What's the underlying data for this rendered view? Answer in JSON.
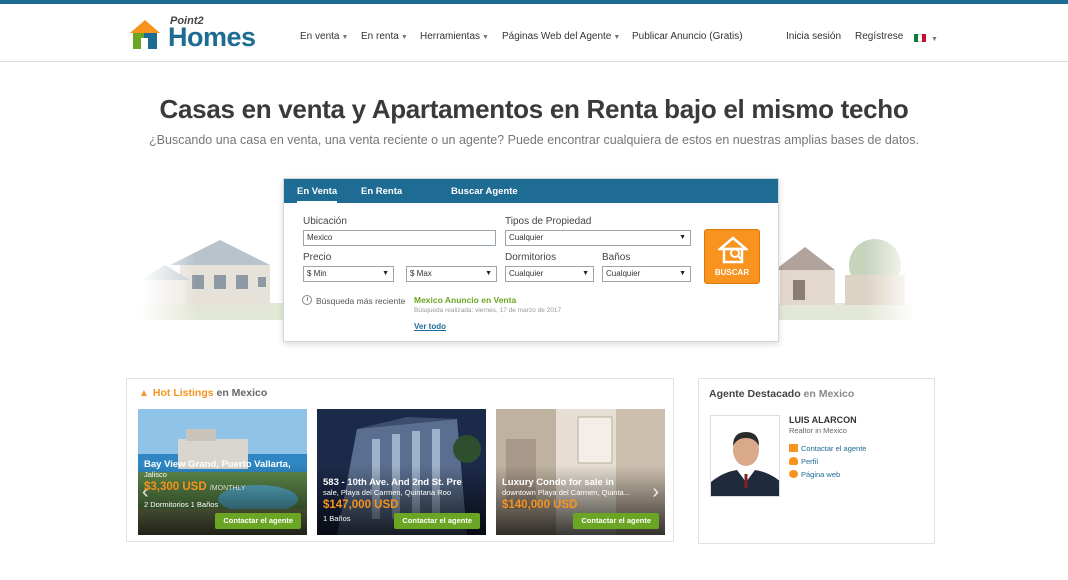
{
  "header": {
    "logo_top": "Point2",
    "logo_main": "Homes",
    "nav": [
      "En venta",
      "En renta",
      "Herramientas",
      "Páginas Web del Agente"
    ],
    "publish": "Publicar Anuncio (Gratis)",
    "login": "Inicia sesión",
    "register": "Regístrese"
  },
  "hero": {
    "title": "Casas en venta y Apartamentos en Renta bajo el mismo techo",
    "subtitle": "¿Buscando una casa en venta, una venta reciente o un agente? Puede encontrar cualquiera de estos en nuestras amplias bases de datos."
  },
  "search": {
    "tabs": [
      "En Venta",
      "En Renta",
      "Buscar Agente"
    ],
    "location_label": "Ubicación",
    "location_value": "Mexico",
    "property_type_label": "Tipos de Propiedad",
    "property_type_value": "Cualquier",
    "price_label": "Precio",
    "price_min": "$ Min",
    "price_max": "$ Max",
    "bedrooms_label": "Dormitorios",
    "bedrooms_value": "Cualquier",
    "baths_label": "Baños",
    "baths_value": "Cualquier",
    "button": "BUSCAR",
    "recent_label": "Búsqueda más reciente",
    "recent_link": "Mexico Anuncio en Venta",
    "recent_date": "Búsqueda realizada: viernes, 17 de marzo de 2017",
    "see_all": "Ver todo"
  },
  "listings": {
    "heading_hl": "Hot Listings",
    "heading_rest": "en Mexico",
    "cards": [
      {
        "title": "Bay View Grand, Puerto Vallarta,",
        "location": "Jalisco",
        "price": "$3,300 USD",
        "period": "/MONTHLY",
        "meta": "2 Dormitorios    1 Baños",
        "button": "Contactar el agente"
      },
      {
        "title": "583 - 10th Ave. And 2nd St. Pre",
        "location": "sale, Playa del Carmen, Quintana Roo",
        "price": "$147,000 USD",
        "period": "",
        "meta": "1 Baños",
        "button": "Contactar el agente"
      },
      {
        "title": "Luxury Condo for sale in",
        "location": "downtown Playa del Carmen, Quinta...",
        "price": "$140,000 USD",
        "period": "",
        "meta": "",
        "button": "Contactar el agente"
      }
    ]
  },
  "agent": {
    "heading": "Agente Destacado",
    "heading_rest": "en Mexico",
    "name": "LUIS ALARCON",
    "role": "Realtor in Mexico",
    "links": [
      "Contactar el agente",
      "Perfil",
      "Página web"
    ]
  },
  "colors": {
    "brand_blue": "#1e6b93",
    "accent_orange": "#f7931e",
    "action_green": "#6aa623"
  }
}
